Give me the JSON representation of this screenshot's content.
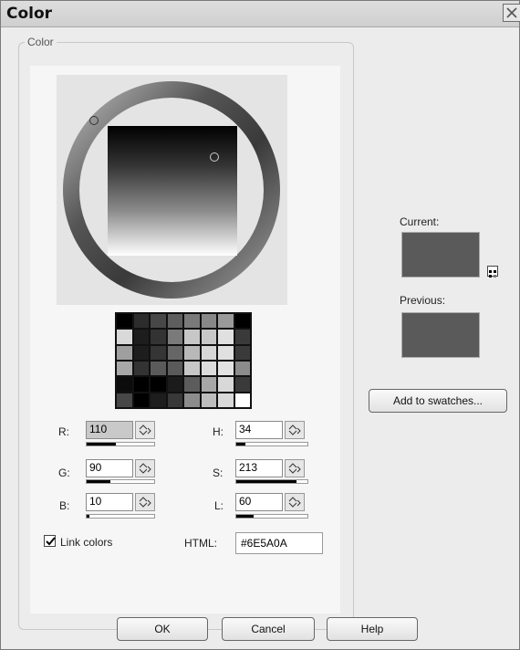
{
  "dialog": {
    "title": "Color",
    "group_label": "Color"
  },
  "color": {
    "r_label": "R:",
    "r_value": "110",
    "r_fraction": 0.43,
    "g_label": "G:",
    "g_value": "90",
    "g_fraction": 0.35,
    "b_label": "B:",
    "b_value": "10",
    "b_fraction": 0.04,
    "h_label": "H:",
    "h_value": "34",
    "h_fraction": 0.13,
    "s_label": "S:",
    "s_value": "213",
    "s_fraction": 0.84,
    "l_label": "L:",
    "l_value": "60",
    "l_fraction": 0.24,
    "html_label": "HTML:",
    "html_value": "#6E5A0A"
  },
  "link_colors": {
    "label": "Link colors",
    "checked": true
  },
  "preview": {
    "current_label": "Current:",
    "previous_label": "Previous:",
    "current_color": "#5a5a5a",
    "previous_color": "#5a5a5a"
  },
  "palette": {
    "cells": [
      "#000000",
      "#2c2c2c",
      "#474747",
      "#5e5e5e",
      "#7a7a7a",
      "#888888",
      "#9a9a9a",
      "#000000",
      "#d9d9d9",
      "#1d1d1d",
      "#333333",
      "#7a7a7a",
      "#c7c7c7",
      "#c7c7c7",
      "#e0e0e0",
      "#3a3a3a",
      "#9f9f9f",
      "#1d1d1d",
      "#353535",
      "#666666",
      "#b8b8b8",
      "#d6d6d6",
      "#e0e0e0",
      "#3a3a3a",
      "#a8a8a8",
      "#333333",
      "#5a5a5a",
      "#5a5a5a",
      "#c7c7c7",
      "#dcdcdc",
      "#e3e3e3",
      "#8c8c8c",
      "#0c0c0c",
      "#000000",
      "#000000",
      "#1b1b1b",
      "#5c5c5c",
      "#a7a7a7",
      "#d8d8d8",
      "#3a3a3a",
      "#474747",
      "#000000",
      "#1d1d1d",
      "#383838",
      "#8c8c8c",
      "#bdbdbd",
      "#d9d9d9",
      "#ffffff"
    ]
  },
  "buttons": {
    "add_to_swatches": "Add to swatches...",
    "ok": "OK",
    "cancel": "Cancel",
    "help": "Help"
  }
}
